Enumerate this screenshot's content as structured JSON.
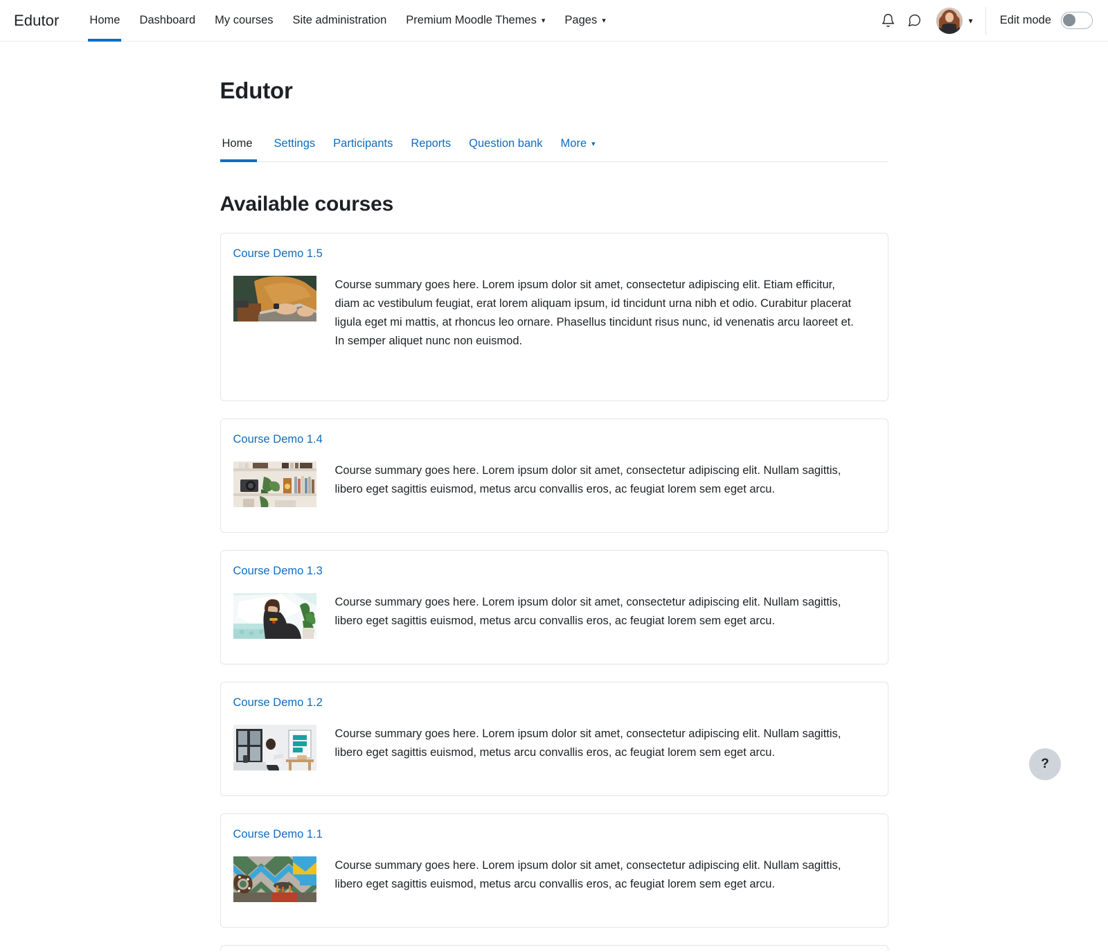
{
  "navbar": {
    "brand": "Edutor",
    "links": [
      {
        "label": "Home",
        "active": true,
        "has_caret": false
      },
      {
        "label": "Dashboard",
        "active": false,
        "has_caret": false
      },
      {
        "label": "My courses",
        "active": false,
        "has_caret": false
      },
      {
        "label": "Site administration",
        "active": false,
        "has_caret": false
      },
      {
        "label": "Premium Moodle Themes",
        "active": false,
        "has_caret": true
      },
      {
        "label": "Pages",
        "active": false,
        "has_caret": true
      }
    ],
    "notifications_icon": "bell-icon",
    "messages_icon": "speech-bubble-icon",
    "avatar_icon": "user-avatar",
    "avatar_caret": "chevron-down-icon",
    "edit_mode_label": "Edit mode",
    "edit_mode_enabled": false,
    "caret_glyph": "⌄"
  },
  "page": {
    "title": "Edutor",
    "section_title": "Available courses"
  },
  "secondary_nav": {
    "items": [
      {
        "label": "Home",
        "active": true,
        "has_caret": false
      },
      {
        "label": "Settings",
        "active": false,
        "has_caret": false
      },
      {
        "label": "Participants",
        "active": false,
        "has_caret": false
      },
      {
        "label": "Reports",
        "active": false,
        "has_caret": false
      },
      {
        "label": "Question bank",
        "active": false,
        "has_caret": false
      },
      {
        "label": "More",
        "active": false,
        "has_caret": true
      }
    ]
  },
  "courses": [
    {
      "name": "Course Demo 1.5",
      "summary": "Course summary goes here. Lorem ipsum dolor sit amet, consectetur adipiscing elit. Etiam efficitur, diam ac vestibulum feugiat, erat lorem aliquam ipsum, id tincidunt urna nibh et odio. Curabitur placerat ligula eget mi mattis, at rhoncus leo ornare. Phasellus tincidunt risus nunc, id venenatis arcu laoreet et. In semper aliquet nunc non euismod.",
      "thumbnail_alt": "Person in mustard sweater typing on a laptop",
      "thumbnail_colors": [
        "#2f4236",
        "#c88c3c",
        "#6b4423",
        "#d9cfc2"
      ]
    },
    {
      "name": "Course Demo 1.4",
      "summary": "Course summary goes here. Lorem ipsum dolor sit amet, consectetur adipiscing elit. Nullam sagittis, libero eget sagittis euismod, metus arcu convallis eros, ac feugiat lorem sem eget arcu.",
      "thumbnail_alt": "Bookshelf with a camera, plant and books",
      "thumbnail_colors": [
        "#e8e2da",
        "#3b3b3d",
        "#4f7a41",
        "#b9752f"
      ]
    },
    {
      "name": "Course Demo 1.3",
      "summary": "Course summary goes here. Lorem ipsum dolor sit amet, consectetur adipiscing elit. Nullam sagittis, libero eget sagittis euismod, metus arcu convallis eros, ac feugiat lorem sem eget arcu.",
      "thumbnail_alt": "Woman in black top seated by a teal sofa with a plant",
      "thumbnail_colors": [
        "#d7ece9",
        "#ffffff",
        "#2b2b2e",
        "#3f7a3a"
      ]
    },
    {
      "name": "Course Demo 1.2",
      "summary": "Course summary goes here. Lorem ipsum dolor sit amet, consectetur adipiscing elit. Nullam sagittis, libero eget sagittis euismod, metus arcu convallis eros, ac feugiat lorem sem eget arcu.",
      "thumbnail_alt": "Person reading by a window next to a framed teal poster",
      "thumbnail_colors": [
        "#e9eaec",
        "#2e3134",
        "#17a2a0",
        "#c79a6b"
      ]
    },
    {
      "name": "Course Demo 1.1",
      "summary": "Course summary goes here. Lorem ipsum dolor sit amet, consectetur adipiscing elit. Nullam sagittis, libero eget sagittis euismod, metus arcu convallis eros, ac feugiat lorem sem eget arcu.",
      "thumbnail_alt": "Letter C marquee sign against a colourful chevron wall",
      "thumbnail_colors": [
        "#4f7a55",
        "#3aa7d8",
        "#f0c020",
        "#5a3a22"
      ]
    }
  ],
  "help": {
    "label": "?",
    "icon": "question-mark-icon"
  }
}
